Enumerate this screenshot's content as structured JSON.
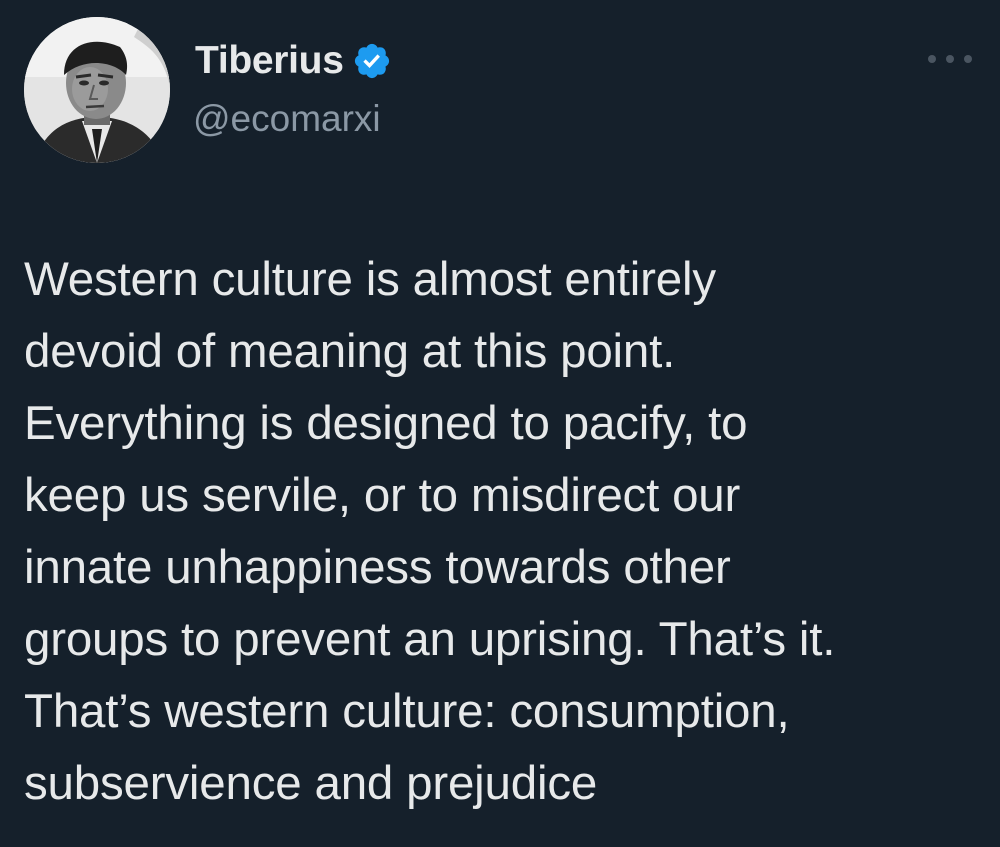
{
  "author": {
    "display_name": "Tiberius",
    "handle": "@ecomarxi",
    "verified": true,
    "avatar_icon": "profile-photo",
    "verified_icon": "verified-badge-icon",
    "verified_color": "#1d9bf0"
  },
  "menu": {
    "icon": "more-options-icon"
  },
  "tweet": {
    "lines": [
      "Western culture is almost entirely",
      "devoid of meaning at this point.",
      "Everything is designed to pacify, to",
      "keep us servile, or to misdirect our",
      "innate unhappiness towards other",
      "groups to prevent an uprising. That’s it.",
      "That’s western culture: consumption,",
      "subservience and prejudice"
    ]
  },
  "colors": {
    "background": "#15202b",
    "text": "#e7e9ea",
    "secondary_text": "#8b98a5"
  }
}
